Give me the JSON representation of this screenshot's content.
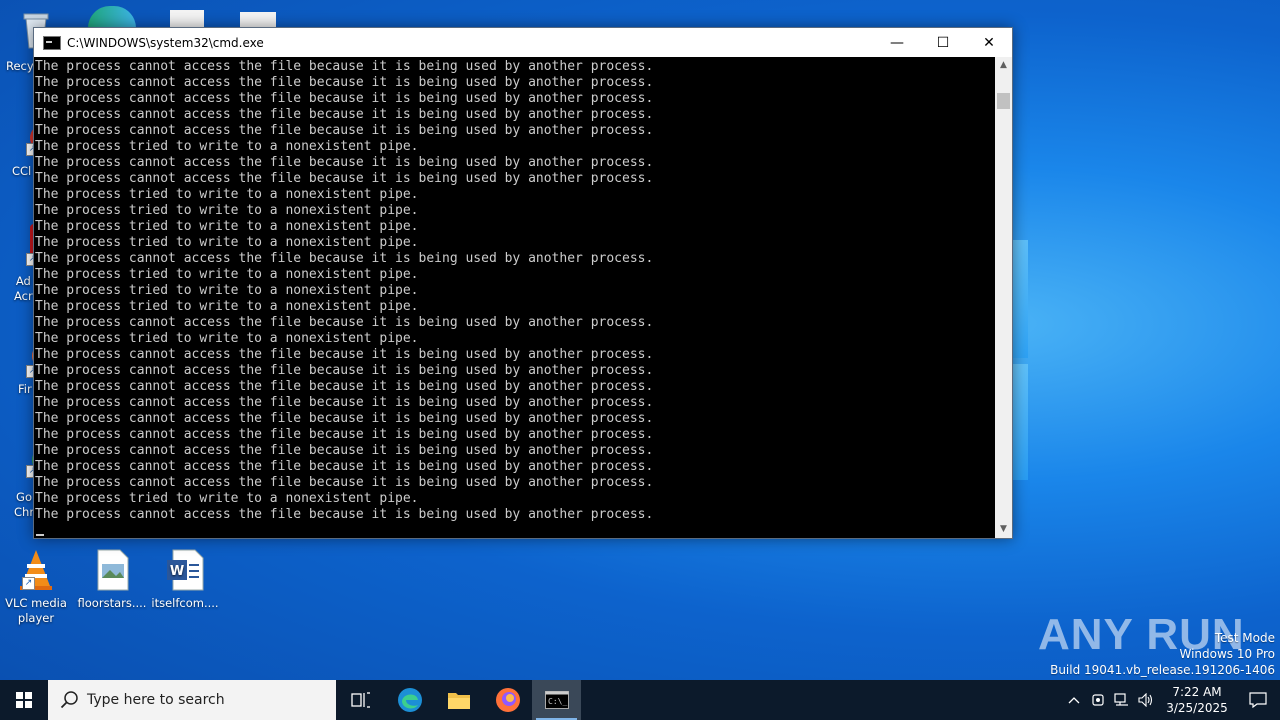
{
  "desktop": {
    "icons_left_column": [
      {
        "label": "Recy",
        "icon": "recycle-bin-icon"
      },
      {
        "label": "CCl",
        "icon": "ccleaner-icon"
      },
      {
        "label": "Ad\nAcr",
        "icon": "adobe-acrobat-icon"
      },
      {
        "label": "Fir",
        "icon": "firefox-icon"
      },
      {
        "label": "Go\nChr",
        "icon": "chrome-icon"
      }
    ],
    "icons_bottom_row": [
      {
        "label": "VLC media player",
        "icon": "vlc-icon"
      },
      {
        "label": "floorstars....",
        "icon": "image-file-icon"
      },
      {
        "label": "itselfcom....",
        "icon": "word-document-icon"
      }
    ]
  },
  "cmd_window": {
    "title": "C:\\WINDOWS\\system32\\cmd.exe",
    "minimize_glyph": "—",
    "maximize_glyph": "☐",
    "close_glyph": "✕",
    "console_lines": [
      "The process cannot access the file because it is being used by another process.",
      "The process cannot access the file because it is being used by another process.",
      "The process cannot access the file because it is being used by another process.",
      "The process cannot access the file because it is being used by another process.",
      "The process cannot access the file because it is being used by another process.",
      "The process tried to write to a nonexistent pipe.",
      "The process cannot access the file because it is being used by another process.",
      "The process cannot access the file because it is being used by another process.",
      "The process tried to write to a nonexistent pipe.",
      "The process tried to write to a nonexistent pipe.",
      "The process tried to write to a nonexistent pipe.",
      "The process tried to write to a nonexistent pipe.",
      "The process cannot access the file because it is being used by another process.",
      "The process tried to write to a nonexistent pipe.",
      "The process tried to write to a nonexistent pipe.",
      "The process tried to write to a nonexistent pipe.",
      "The process cannot access the file because it is being used by another process.",
      "The process tried to write to a nonexistent pipe.",
      "The process cannot access the file because it is being used by another process.",
      "The process cannot access the file because it is being used by another process.",
      "The process cannot access the file because it is being used by another process.",
      "The process cannot access the file because it is being used by another process.",
      "The process cannot access the file because it is being used by another process.",
      "The process cannot access the file because it is being used by another process.",
      "The process cannot access the file because it is being used by another process.",
      "The process cannot access the file because it is being used by another process.",
      "The process cannot access the file because it is being used by another process.",
      "The process tried to write to a nonexistent pipe.",
      "The process cannot access the file because it is being used by another process."
    ]
  },
  "watermark": {
    "brand": "ANY RUN",
    "test_mode": "Test Mode",
    "edition": "Windows 10 Pro",
    "build": "Build 19041.vb_release.191206-1406"
  },
  "taskbar": {
    "search_placeholder": "Type here to search",
    "pinned": [
      "task-view-icon",
      "edge-icon",
      "file-explorer-icon",
      "firefox-icon",
      "cmd-icon"
    ],
    "clock_time": "7:22 AM",
    "clock_date": "3/25/2025"
  },
  "colors": {
    "console_bg": "#000000",
    "console_text": "#cccccc",
    "taskbar_bg": "#0c1a2b",
    "desktop_accent": "#1a86ea"
  }
}
